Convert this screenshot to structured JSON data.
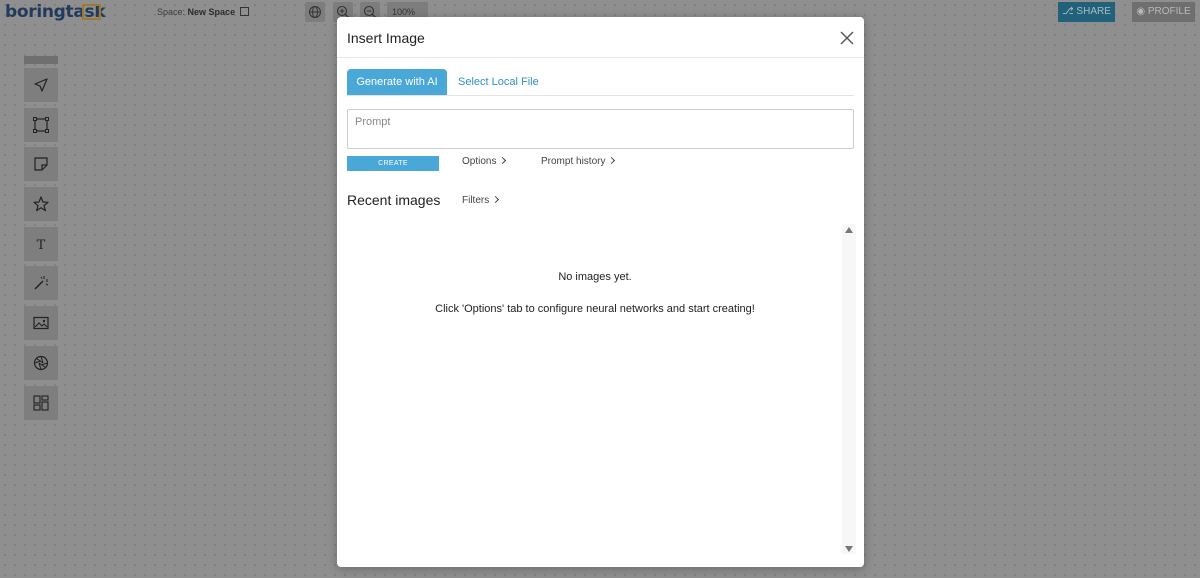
{
  "app": {
    "logo_text": "boringtask",
    "space_label": "Space:",
    "space_name": "New Space",
    "zoom_level": "100%",
    "share_label": "SHARE",
    "profile_label": "PROFILE"
  },
  "toolbar": {
    "tools": [
      "pointer-icon",
      "frame-icon",
      "sticky-note-icon",
      "star-icon",
      "text-icon",
      "magic-wand-icon",
      "image-icon",
      "aperture-icon",
      "layout-icon"
    ]
  },
  "modal": {
    "title": "Insert Image",
    "tabs": [
      {
        "label": "Generate with AI",
        "active": true
      },
      {
        "label": "Select Local File",
        "active": false
      }
    ],
    "prompt_placeholder": "Prompt",
    "prompt_value": "",
    "create_label": "CREATE",
    "options_label": "Options",
    "prompt_history_label": "Prompt history",
    "recent_images_label": "Recent images",
    "filters_label": "Filters",
    "empty_title": "No images yet.",
    "empty_hint": "Click 'Options' tab to configure neural networks and start creating!"
  },
  "colors": {
    "accent": "#4aa8d8",
    "link": "#2f8fbf",
    "overlay": "#8f8f8f"
  }
}
